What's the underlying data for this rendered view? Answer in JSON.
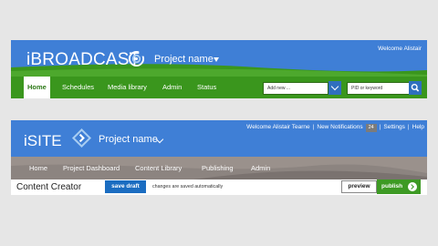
{
  "ibroadcast": {
    "logo": "iBROADCAST",
    "logo_icon": "broadcast-target-icon",
    "project_name": "Project name",
    "welcome": "Welcome Alistair",
    "nav": [
      "Home",
      "Schedules",
      "Media library",
      "Admin",
      "Status"
    ],
    "active_tab": "Home",
    "add_placeholder": "Add new ...",
    "search_placeholder": "PID or keyword",
    "colors": {
      "header": "#3f7fd6",
      "nav": "#3a961d",
      "button": "#2f6fbe"
    }
  },
  "isite": {
    "logo": "iSITE",
    "logo_icon": "diamond-arrows-icon",
    "project_name": "Project name",
    "welcome": "Welcome Alistair Tearne",
    "notifications_label": "New Notifications",
    "notifications_count": "24",
    "settings": "Settings",
    "help": "Help",
    "nav": [
      "Home",
      "Project Dashboard",
      "Content Library",
      "Publishing",
      "Admin"
    ],
    "page_title": "Content Creator",
    "save_draft": "save draft",
    "status": "changes are saved automatically",
    "preview": "preview",
    "publish": "publish",
    "colors": {
      "header": "#3f7fd6",
      "nav": "#8c8480",
      "save": "#1b6dc1",
      "publish": "#3d9a24"
    }
  }
}
